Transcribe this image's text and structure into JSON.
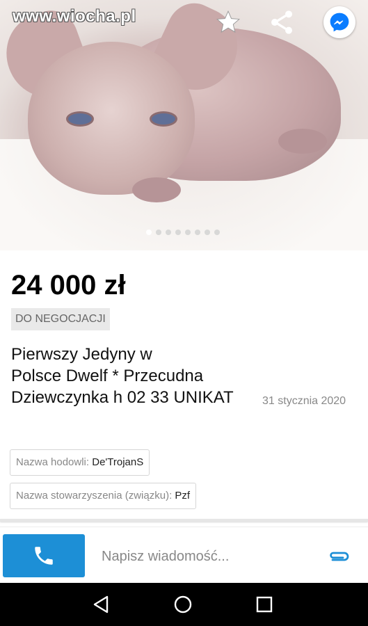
{
  "watermark": "www.wiocha.pl",
  "gallery": {
    "total_images": 8,
    "current_index": 1
  },
  "listing": {
    "price": "24 000 zł",
    "negotiable_badge": "DO NEGOCJACJI",
    "title_line1": "Pierwszy Jedyny w",
    "title_line2": "Polsce Dwelf * Przecudna",
    "title_line3": "Dziewczynka h 02 33 UNIKAT",
    "date": "31 stycznia 2020",
    "params": [
      {
        "label": "Nazwa hodowli:",
        "value": "De'TrojanS"
      },
      {
        "label": "Nazwa stowarzyszenia (związku):",
        "value": "Pzf"
      }
    ]
  },
  "message": {
    "placeholder": "Napisz wiadomość..."
  },
  "icons": {
    "favorite": "star-icon",
    "share": "share-icon",
    "messenger": "messenger-icon",
    "call": "phone-icon",
    "attach": "paperclip-icon",
    "nav_back": "back-triangle-icon",
    "nav_home": "home-circle-icon",
    "nav_recent": "recent-apps-square-icon"
  },
  "colors": {
    "accent": "#1d8fd6",
    "messenger": "#0a7cff",
    "navbar": "#000000"
  }
}
